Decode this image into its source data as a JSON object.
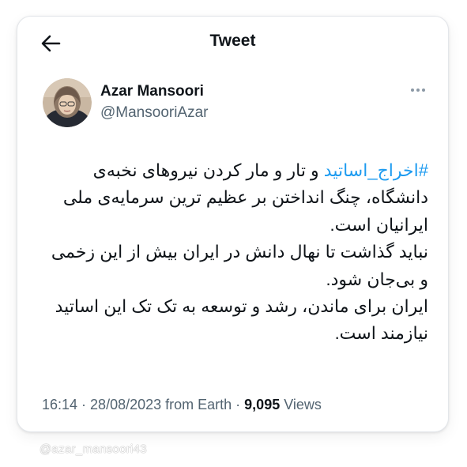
{
  "header": {
    "back_icon": "arrow-left-icon",
    "title": "Tweet"
  },
  "author": {
    "name": "Azar Mansoori",
    "handle": "@MansooriAzar",
    "avatar_icon": "profile-photo-avatar",
    "more_icon": "more-horizontal-icon"
  },
  "tweet": {
    "hashtag": "#اخراج_اساتید",
    "line1_rest": " و تار و مار کردن نیروهای نخبه‌ی",
    "line2": "دانشگاه، چنگ انداختن بر عظیم ترین سرمایه‌ی ملی",
    "line3": "ایرانیان است.",
    "line4": " نباید گذاشت تا نهال دانش در ایران بیش از این زخمی",
    "line5": "و بی‌جان شود.",
    "line6": "ایران برای ماندن، رشد و توسعه به تک تک این اساتید",
    "line7": "نیازمند است."
  },
  "meta": {
    "time": "16:14",
    "sep1": " · ",
    "date": "28/08/2023",
    "source": " from Earth",
    "sep2": " · ",
    "views_count": "9,095",
    "views_label": " Views"
  },
  "watermark": "@azar_mansoori43",
  "colors": {
    "text": "#0f1419",
    "secondary": "#536471",
    "link": "#1d9bf0"
  }
}
